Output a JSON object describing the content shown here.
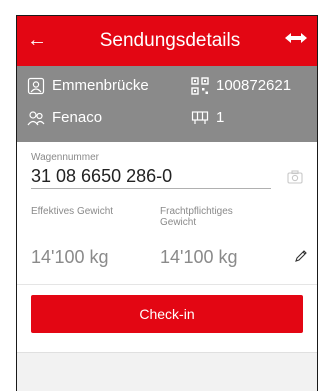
{
  "header": {
    "back_icon": "arrow-left-icon",
    "title": "Sendungsdetails",
    "swap_icon": "left-right-arrow-icon",
    "color": "#e30613"
  },
  "info": {
    "location": "Emmenbrücke",
    "consignee": "Fenaco",
    "shipment_number": "100872621",
    "wagon_count": "1",
    "background": "#8a8a8a"
  },
  "form": {
    "wagon_label": "Wagennummer",
    "wagon_value": "31 08 6650 286-0",
    "effective_weight_label": "Effektives Gewicht",
    "freight_weight_label_line1": "Frachtpflichtiges",
    "freight_weight_label_line2": "Gewicht",
    "effective_weight_value": "14'100 kg",
    "freight_weight_value": "14'100 kg"
  },
  "actions": {
    "checkin_label": "Check-in"
  }
}
